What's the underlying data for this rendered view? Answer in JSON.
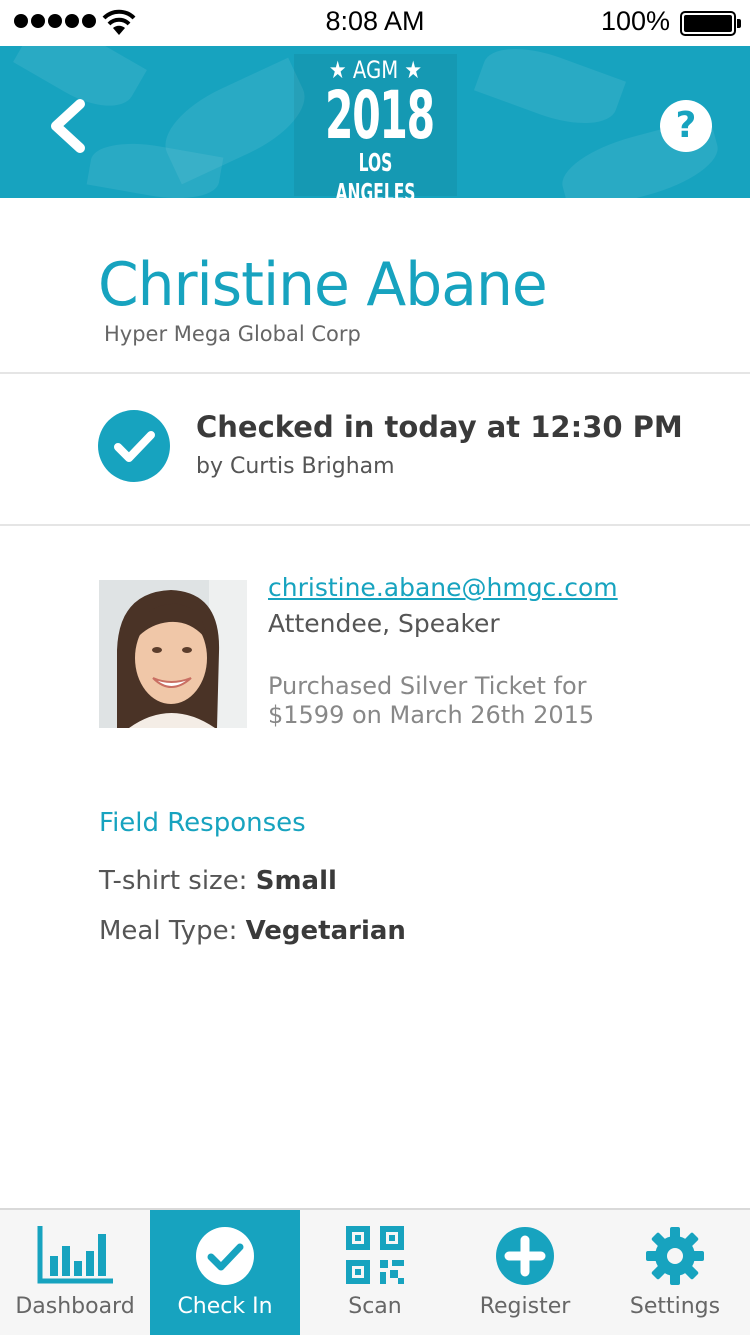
{
  "status_bar": {
    "time": "8:08 AM",
    "battery": "100%"
  },
  "header": {
    "logo_top": "★ AGM ★",
    "logo_year": "2018",
    "logo_city": "LOS ANGELES",
    "help_label": "?"
  },
  "attendee": {
    "name": "Christine Abane",
    "company": "Hyper Mega Global Corp",
    "email": "christine.abane@hmgc.com",
    "roles": "Attendee, Speaker",
    "ticket_line1": "Purchased Silver Ticket for",
    "ticket_line2": "$1599 on March 26th 2015"
  },
  "checkin": {
    "title": "Checked in today at 12:30 PM",
    "by": "by Curtis Brigham"
  },
  "fields": {
    "title": "Field Responses",
    "items": [
      {
        "label": "T-shirt size: ",
        "value": "Small"
      },
      {
        "label": "Meal Type: ",
        "value": "Vegetarian"
      }
    ]
  },
  "tabs": [
    {
      "label": "Dashboard",
      "icon": "bar-chart-icon",
      "active": false
    },
    {
      "label": "Check In",
      "icon": "checkmark-icon",
      "active": true
    },
    {
      "label": "Scan",
      "icon": "qr-code-icon",
      "active": false
    },
    {
      "label": "Register",
      "icon": "plus-icon",
      "active": false
    },
    {
      "label": "Settings",
      "icon": "gear-icon",
      "active": false
    }
  ],
  "colors": {
    "accent": "#17a3bf",
    "tabbar_bg": "#f6f6f6"
  }
}
